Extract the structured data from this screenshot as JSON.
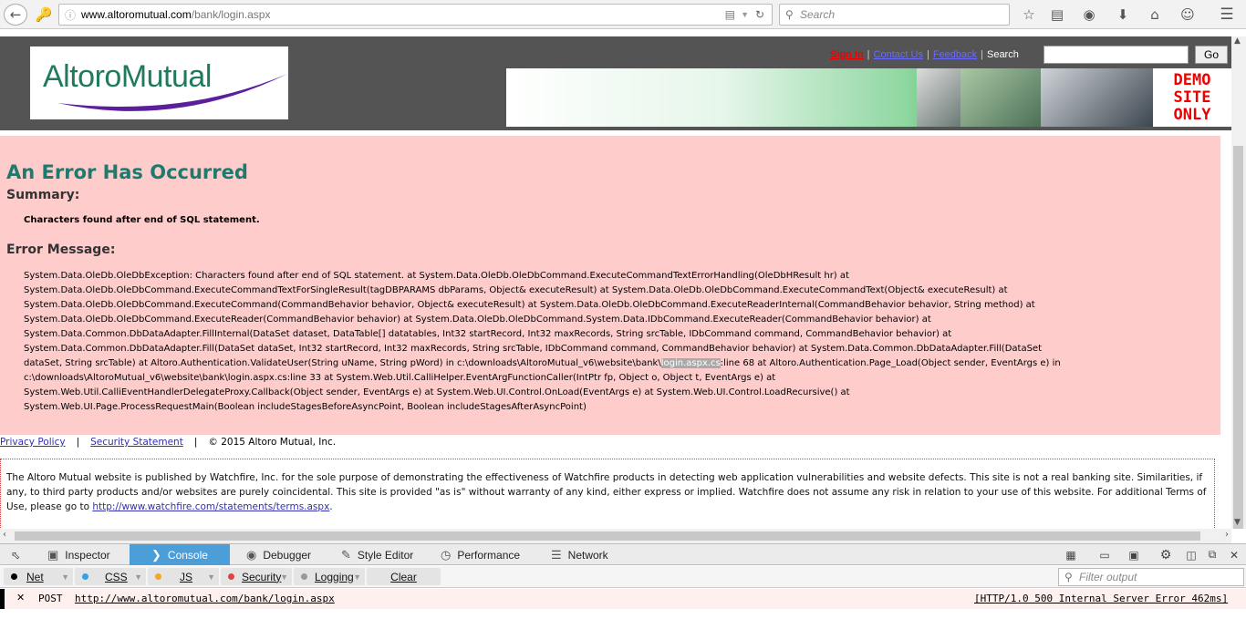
{
  "browser": {
    "url_host": "www.altoromutual.com",
    "url_path": "/bank/login.aspx",
    "search_placeholder": "Search"
  },
  "header": {
    "logo_text": "AltoroMutual",
    "sign_in": "Sign In",
    "contact": "Contact Us",
    "feedback": "Feedback",
    "search_label": "Search",
    "go_label": "Go",
    "demo_lines": [
      "DEMO",
      "SITE",
      "ONLY"
    ]
  },
  "error": {
    "title": "An Error Has Occurred",
    "summary_heading": "Summary:",
    "summary": "Characters found after end of SQL statement.",
    "message_heading": "Error Message:",
    "lines": [
      "System.Data.OleDb.OleDbException: Characters found after end of SQL statement. at System.Data.OleDb.OleDbCommand.ExecuteCommandTextErrorHandling(OleDbHResult hr) at",
      "System.Data.OleDb.OleDbCommand.ExecuteCommandTextForSingleResult(tagDBPARAMS dbParams, Object& executeResult) at System.Data.OleDb.OleDbCommand.ExecuteCommandText(Object& executeResult) at",
      "System.Data.OleDb.OleDbCommand.ExecuteCommand(CommandBehavior behavior, Object& executeResult) at System.Data.OleDb.OleDbCommand.ExecuteReaderInternal(CommandBehavior behavior, String method) at",
      "System.Data.OleDb.OleDbCommand.ExecuteReader(CommandBehavior behavior) at System.Data.OleDb.OleDbCommand.System.Data.IDbCommand.ExecuteReader(CommandBehavior behavior) at",
      "System.Data.Common.DbDataAdapter.FillInternal(DataSet dataset, DataTable[] datatables, Int32 startRecord, Int32 maxRecords, String srcTable, IDbCommand command, CommandBehavior behavior) at",
      "System.Data.Common.DbDataAdapter.Fill(DataSet dataSet, Int32 startRecord, Int32 maxRecords, String srcTable, IDbCommand command, CommandBehavior behavior) at System.Data.Common.DbDataAdapter.Fill(DataSet"
    ],
    "line7_pre": "dataSet, String srcTable) at Altoro.Authentication.ValidateUser(String uName, String pWord) in c:\\downloads\\AltoroMutual_v6\\website\\bank\\",
    "line7_hl": "login.aspx.cs",
    "line7_post": ":line 68 at Altoro.Authentication.Page_Load(Object sender, EventArgs e) in",
    "lines_tail": [
      "c:\\downloads\\AltoroMutual_v6\\website\\bank\\login.aspx.cs:line 33 at System.Web.Util.CalliHelper.EventArgFunctionCaller(IntPtr fp, Object o, Object t, EventArgs e) at",
      "System.Web.Util.CalliEventHandlerDelegateProxy.Callback(Object sender, EventArgs e) at System.Web.UI.Control.OnLoad(EventArgs e) at System.Web.UI.Control.LoadRecursive() at",
      "System.Web.UI.Page.ProcessRequestMain(Boolean includeStagesBeforeAsyncPoint, Boolean includeStagesAfterAsyncPoint)"
    ]
  },
  "footer": {
    "privacy": "Privacy Policy",
    "security": "Security Statement",
    "copyright": "© 2015 Altoro Mutual, Inc.",
    "disclaimer": "The Altoro Mutual website is published by Watchfire, Inc. for the sole purpose of demonstrating the effectiveness of Watchfire products in detecting web application vulnerabilities and website defects. This site is not a real banking site. Similarities, if any, to third party products and/or websites are purely coincidental. This site is provided \"as is\" without warranty of any kind, either express or implied. Watchfire does not assume any risk in relation to your use of this website. For additional Terms of Use, please go to",
    "terms_link": "http://www.watchfire.com/statements/terms.aspx",
    "terms_end": "."
  },
  "devtools": {
    "tabs": [
      "Inspector",
      "Console",
      "Debugger",
      "Style Editor",
      "Performance",
      "Network"
    ],
    "active_tab": "Console",
    "filters": [
      "Net",
      "CSS",
      "JS",
      "Security",
      "Logging"
    ],
    "clear": "Clear",
    "filter_placeholder": "Filter output",
    "log": {
      "method": "POST",
      "url": "http://www.altoromutual.com/bank/login.aspx",
      "status": "[HTTP/1.0 500 Internal Server Error 462ms]"
    }
  },
  "colors": {
    "error_bg": "#ffcccc",
    "title_teal": "#1f7a6e",
    "active_tab": "#4c9ed9"
  }
}
